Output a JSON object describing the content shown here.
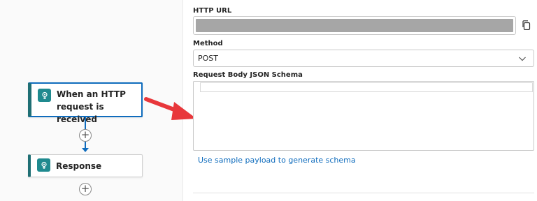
{
  "canvas": {
    "trigger_node": {
      "label": "When an HTTP request is received",
      "icon": "http-trigger-icon"
    },
    "response_node": {
      "label": "Response",
      "icon": "http-response-icon"
    },
    "add_step_icon": "plus-icon"
  },
  "panel": {
    "http_url": {
      "label": "HTTP URL",
      "value_masked": true,
      "copy_icon": "copy-icon"
    },
    "method": {
      "label": "Method",
      "value": "POST",
      "icon": "chevron-down-icon"
    },
    "schema": {
      "label": "Request Body JSON Schema",
      "value": ""
    },
    "sample_payload_link": "Use sample payload to generate schema"
  },
  "colors": {
    "accent": "#0f6cbd",
    "node_icon": "#1f8a8f",
    "annotation_arrow": "#e8373b",
    "masked": "#a6a6a6"
  }
}
